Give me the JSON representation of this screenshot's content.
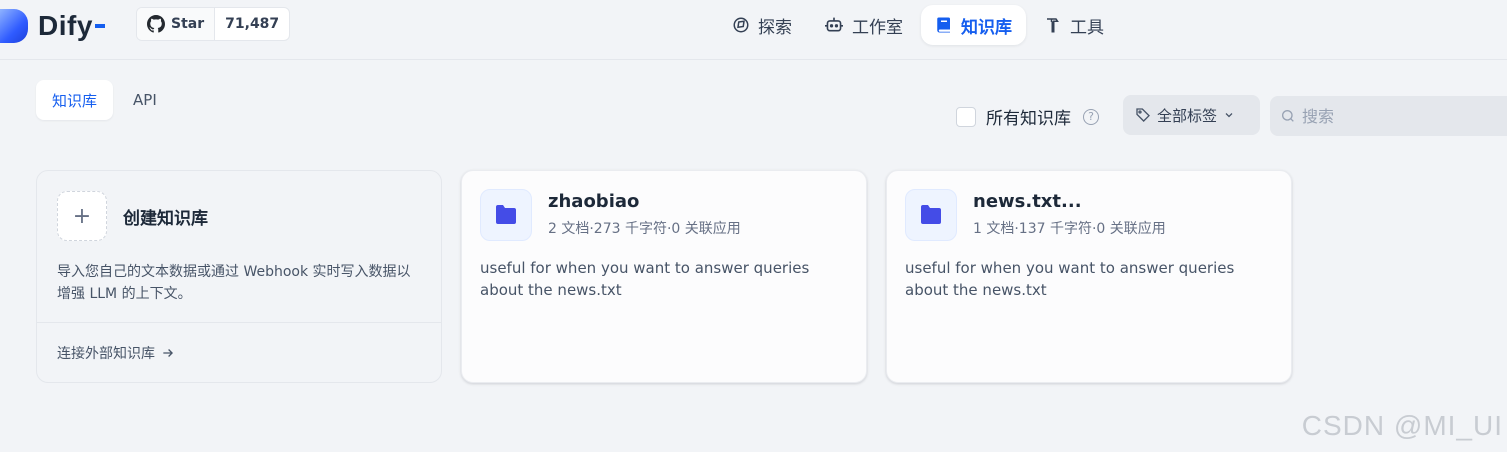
{
  "app": {
    "name": "Dify",
    "github": {
      "label": "Star",
      "count": "71,487",
      "icon": "github-icon"
    }
  },
  "nav": {
    "items": [
      {
        "label": "探索",
        "icon": "compass-icon",
        "active": false
      },
      {
        "label": "工作室",
        "icon": "robot-icon",
        "active": false
      },
      {
        "label": "知识库",
        "icon": "book-icon",
        "active": true
      },
      {
        "label": "工具",
        "icon": "hammer-icon",
        "active": false
      }
    ]
  },
  "tabs": [
    {
      "label": "知识库",
      "active": true
    },
    {
      "label": "API",
      "active": false
    }
  ],
  "filters": {
    "all_label": "所有知识库",
    "tag_label": "全部标签",
    "search_placeholder": "搜索"
  },
  "create": {
    "title": "创建知识库",
    "description": "导入您自己的文本数据或通过 Webhook 实时写入数据以增强 LLM 的上下文。",
    "link": "连接外部知识库"
  },
  "datasets": [
    {
      "name": "zhaobiao",
      "meta": "2 文档·273 千字符·0 关联应用",
      "description": "useful for when you want to answer queries about the news.txt"
    },
    {
      "name": "news.txt...",
      "meta": "1 文档·137 千字符·0 关联应用",
      "description": "useful for when you want to answer queries about the news.txt"
    }
  ],
  "watermark": "CSDN @MI_UI",
  "colors": {
    "accent": "#155eef",
    "folder": "#444ce7",
    "background": "#f2f4f7"
  }
}
